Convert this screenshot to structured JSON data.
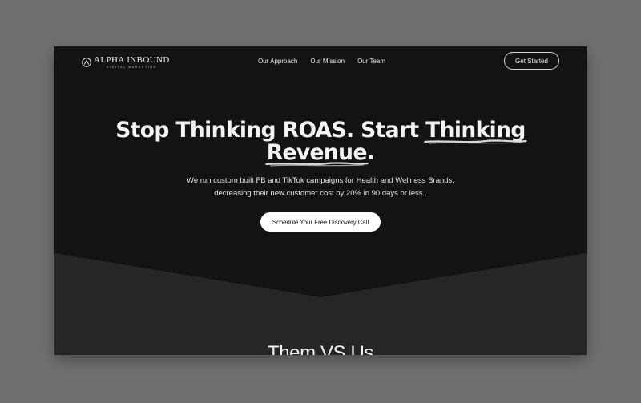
{
  "brand": {
    "name": "ALPHA INBOUND",
    "tagline": "DIGITAL MARKETING",
    "logo_icon": "alpha-mountain-icon"
  },
  "nav": {
    "items": [
      {
        "label": "Our Approach"
      },
      {
        "label": "Our Mission"
      },
      {
        "label": "Our Team"
      }
    ],
    "cta_label": "Get Started"
  },
  "hero": {
    "title_part1": "Stop Thinking ROAS. Start ",
    "title_highlight1": "Thinking",
    "title_highlight2": "Revenue",
    "title_end": ".",
    "subtitle_line1": "We run custom built FB and TikTok campaigns for Health and Wellness Brands,",
    "subtitle_line2": "decreasing their new customer cost by 20% in 90 days or less..",
    "cta_label": "Schedule Your Free Discovery Call"
  },
  "next_section": {
    "heading": "Them VS Us"
  },
  "colors": {
    "page_background": "#707070",
    "hero_background": "#131313",
    "lower_section_background": "#262626",
    "text_primary": "#f3f3f3",
    "button_light": "#ffffff"
  }
}
